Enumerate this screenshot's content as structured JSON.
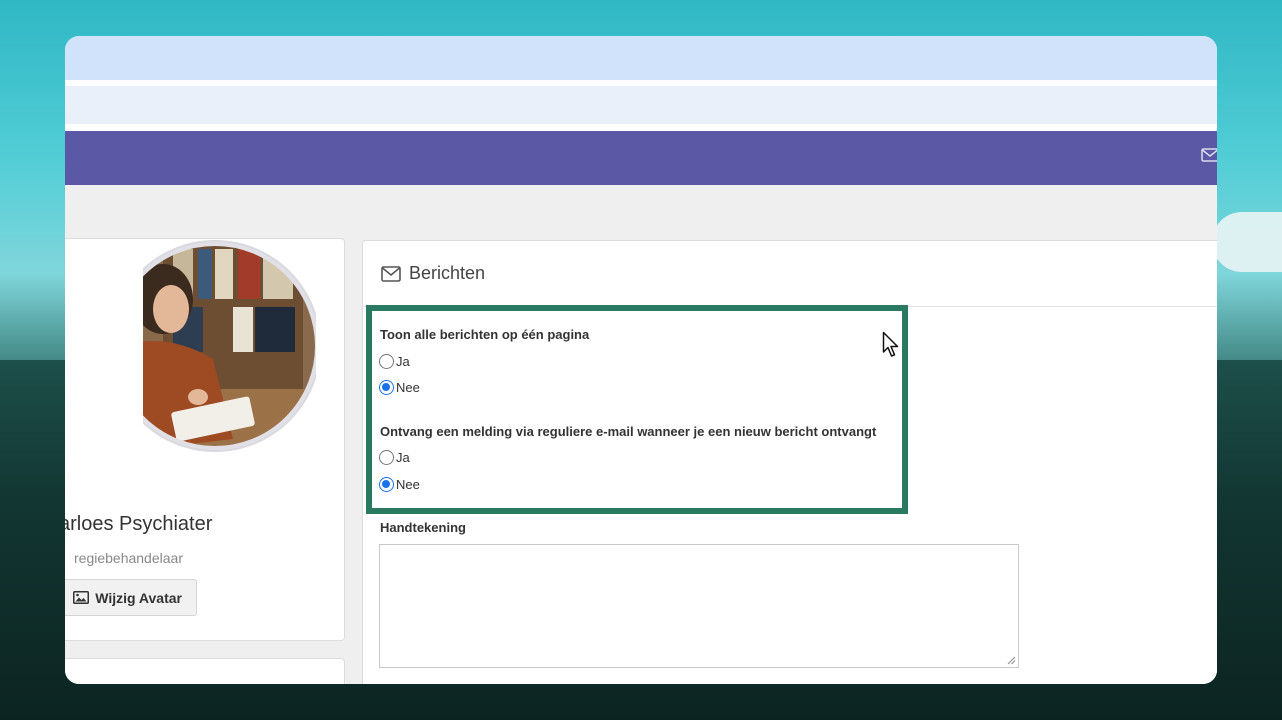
{
  "colors": {
    "navbar": "#5b58a5",
    "highlight_border": "#2a7a62",
    "radio_checked": "#1a73e8"
  },
  "profile": {
    "name": "arloes Psychiater",
    "role": "regiebehandelaar",
    "avatar_button_label": "Wijzig Avatar",
    "avatar_icon": "image-icon"
  },
  "messages": {
    "title": "Berichten",
    "title_icon": "envelope-icon",
    "setting_one": {
      "label": "Toon alle berichten op één pagina",
      "options": [
        "Ja",
        "Nee"
      ],
      "selected": "Nee"
    },
    "setting_two": {
      "label": "Ontvang een melding via reguliere e-mail wanneer je een nieuw bericht ontvangt",
      "options": [
        "Ja",
        "Nee"
      ],
      "selected": "Nee"
    },
    "signature_label": "Handtekening",
    "signature_value": ""
  },
  "navbar": {
    "mail_icon": "envelope-icon"
  }
}
